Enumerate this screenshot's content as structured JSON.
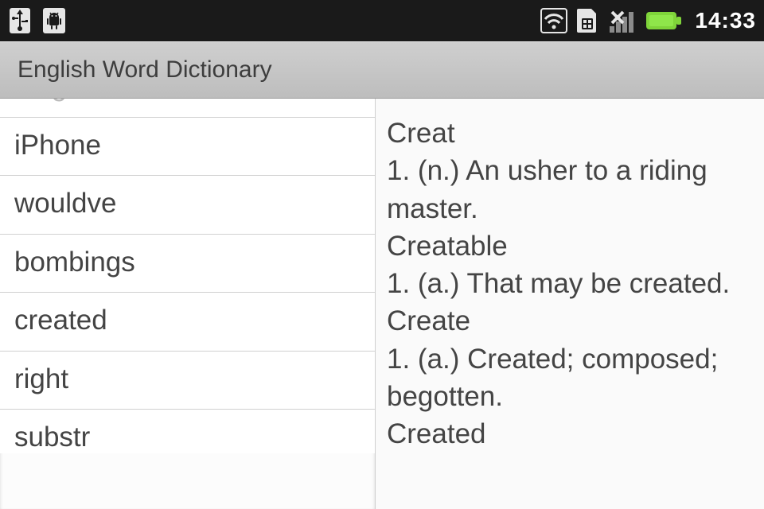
{
  "status_bar": {
    "clock": "14:33"
  },
  "title_bar": {
    "title": "English Word Dictionary"
  },
  "word_list": [
    "religion",
    "iPhone",
    "wouldve",
    "bombings",
    "created",
    "right",
    "substr"
  ],
  "definition_text": "Creat\n1. (n.) An usher to a riding master.\nCreatable\n1. (a.) That may be created.\nCreate\n1. (a.) Created; composed; begotten.\nCreated"
}
